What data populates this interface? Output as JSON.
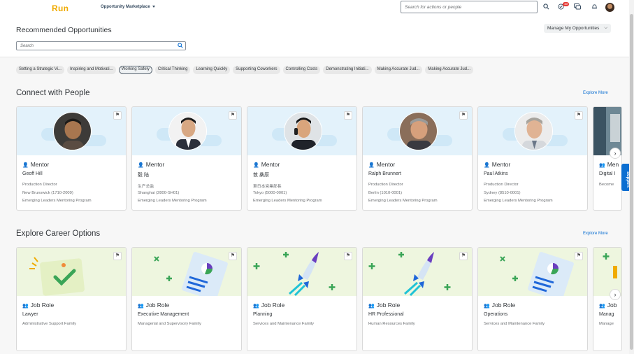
{
  "app": {
    "logo": "Run",
    "menu_label": "Opportunity Marketplace",
    "search_placeholder": "Search for actions or people",
    "notification_count": "10"
  },
  "header": {
    "title": "Recommended Opportunities",
    "manage_label": "Manage My Opportunities",
    "search_placeholder": "Search"
  },
  "chips": [
    {
      "label": "Setting a Strategic Vi...",
      "selected": false
    },
    {
      "label": "Inspiring and Motivati...",
      "selected": false
    },
    {
      "label": "Working Safely",
      "selected": true
    },
    {
      "label": "Critical Thinking",
      "selected": false
    },
    {
      "label": "Learning Quickly",
      "selected": false
    },
    {
      "label": "Supporting Coworkers",
      "selected": false
    },
    {
      "label": "Controlling Costs",
      "selected": false
    },
    {
      "label": "Demonstrating Initiati...",
      "selected": false
    },
    {
      "label": "Making Accurate Jud...",
      "selected": false
    },
    {
      "label": "Making Accurate Jud...",
      "selected": false
    }
  ],
  "people": {
    "title": "Connect with People",
    "explore_more": "Explore More",
    "cards": [
      {
        "type": "Mentor",
        "name": "Geoff Hill",
        "line1": "Production Director",
        "line2": "New Brunswick (1710-2009)",
        "line3": "Emerging Leaders Mentoring Program"
      },
      {
        "type": "Mentor",
        "name": "毅 陆",
        "line1": "生产总监",
        "line2": "Shanghai (2800-SH01)",
        "line3": "Emerging Leaders Mentoring Program"
      },
      {
        "type": "Mentor",
        "name": "敦 桑原",
        "line1": "東日本営業部長",
        "line2": "Tokyo (5000-0001)",
        "line3": "Emerging Leaders Mentoring Program"
      },
      {
        "type": "Mentor",
        "name": "Ralph Brunnert",
        "line1": "Production Director",
        "line2": "Berlin (1010-0001)",
        "line3": "Emerging Leaders Mentoring Program"
      },
      {
        "type": "Mentor",
        "name": "Paul Atkins",
        "line1": "Production Director",
        "line2": "Sydney (8510-0001)",
        "line3": "Emerging Leaders Mentoring Program"
      },
      {
        "type": "Men",
        "name": "Digital I",
        "line1": "Become",
        "line2": "",
        "line3": ""
      }
    ]
  },
  "career": {
    "title": "Explore Career Options",
    "explore_more": "Explore More",
    "cards": [
      {
        "type": "Job Role",
        "name": "Lawyer",
        "line1": "Administrative Support Family"
      },
      {
        "type": "Job Role",
        "name": "Executive Management",
        "line1": "Managerial and Supervisory Family"
      },
      {
        "type": "Job Role",
        "name": "Planning",
        "line1": "Services and Maintenance Family"
      },
      {
        "type": "Job Role",
        "name": "HR Professional",
        "line1": "Human Resources Family"
      },
      {
        "type": "Job Role",
        "name": "Operations",
        "line1": "Services and Maintenance Family"
      },
      {
        "type": "Job",
        "name": "Manag",
        "line1": "Manage"
      }
    ]
  },
  "support_label": "Support",
  "colors": {
    "accent": "#0a6ed1",
    "logo": "#f0ab00",
    "banner_blue": "#e3f2fb",
    "banner_green": "#eef6df"
  }
}
